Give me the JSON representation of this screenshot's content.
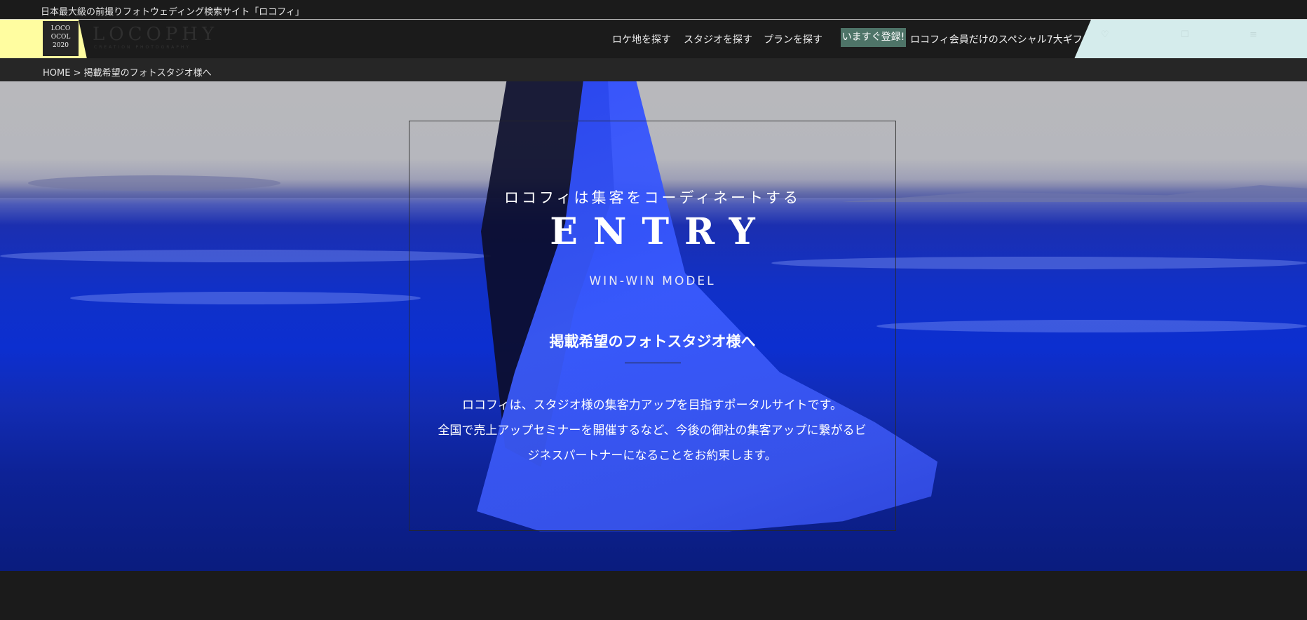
{
  "topbar": {
    "tagline": "日本最大級の前撮りフォトウェディング検索サイト「ロコフィ」"
  },
  "header": {
    "logo_lines": [
      "LOCO",
      "OCOL",
      "2020"
    ],
    "logo_word": "LOCOPHY",
    "logo_sub": "CREATION PHOTOGRAPHY",
    "nav": [
      "ロケ地を探す",
      "スタジオを探す",
      "プランを探す"
    ],
    "badge": "いますぐ登録!",
    "promo": "ロコフィ会員だけのスペシャル7大ギフト!"
  },
  "breadcrumb": {
    "home": "HOME",
    "separator": ">",
    "current": "掲載希望のフォトスタジオ様へ"
  },
  "hero": {
    "catch": "ロコフィは集客をコーディネートする",
    "title": "ENTRY",
    "subtitle": "WIN-WIN MODEL",
    "heading": "掲載希望のフォトスタジオ様へ",
    "body_lines": [
      "ロコフィは、スタジオ様の集客力アップを目指すポータルサイトです。",
      "全国で売上アップセミナーを開催するなど、今後の御社の集客アップに繋がるビ",
      "ジネスパートナーになることをお約束します。"
    ]
  },
  "colors": {
    "badge": "#4e7468",
    "logo_accent": "#fffda0",
    "header_right_panel": "#d5ecec",
    "hero_blue": "#0c2fd0",
    "bg": "#1b1b1b"
  }
}
